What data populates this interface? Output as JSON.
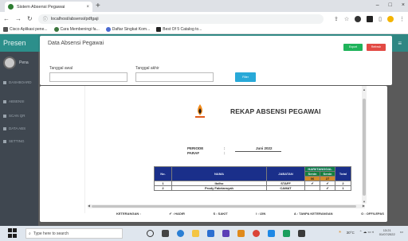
{
  "browser": {
    "tab_title": "Sistem Absensi Pegawai",
    "new_tab": "+",
    "close": "×",
    "win_min": "–",
    "win_max": "□",
    "win_close": "×",
    "url": "localhost/absensi/pdfgaji",
    "bookmarks": [
      {
        "label": "Cisco Aplikasi pene...",
        "color": "#555555"
      },
      {
        "label": "Cara Membeningi fa...",
        "color": "#3c763d"
      },
      {
        "label": "Daftar Singkat Kom...",
        "color": "#4a6ad0"
      },
      {
        "label": "Best Of 5 Catalog to...",
        "color": "#222222"
      }
    ]
  },
  "sidebar": {
    "brand": "Presen",
    "profile_name": "Pena",
    "items": [
      "DASHBOARD",
      "ABSENSI",
      "SCAN QR",
      "DATA ABS",
      "SETTING"
    ]
  },
  "header": {
    "title": "Data Absensi Pegawai",
    "green_button": "Export",
    "red_button": "Refresh",
    "tanggal_awal_label": "Tanggal awal",
    "tanggal_akhir_label": "Tanggal akhir",
    "tanggal_awal_value": "",
    "tanggal_akhir_value": "",
    "filter_button": "Filter"
  },
  "report": {
    "title": "REKAP ABSENSI PEGAWAI",
    "periode_label": "PERIODE",
    "periode_sep": ":",
    "periode_value": "Juni 2022",
    "paraf_label": "PARAF",
    "paraf_sep": ":",
    "columns": {
      "no": "No.",
      "nama": "NAMA",
      "jabatan": "JABATAN",
      "hari_tanggal": "HARI/TANGGAL",
      "day1": "Senin",
      "day2": "Senin",
      "date1": "06",
      "date2": "27",
      "total": "Total"
    },
    "rows": [
      {
        "no": "1",
        "nama": "Ibdho",
        "jabatan": "STAFF",
        "d1": "✔",
        "d2": "✔",
        "total": "2"
      },
      {
        "no": "2",
        "nama": "Prody Fabriansyah",
        "jabatan": "CAMAT",
        "d1": "",
        "d2": "✔",
        "total": "1"
      }
    ],
    "legend": {
      "keterangan": "KETERANGAN :",
      "hadir": "✔ : HADIR",
      "sakit": "S : SAKIT",
      "izin": "I : IJIN",
      "alpa": "A : TANPA KETERANGAN",
      "off": "O : OFF/LEPAS"
    }
  },
  "taskbar": {
    "search_placeholder": "Type here to search",
    "weather": "30°C",
    "time": "13:21",
    "date": "01/07/2022"
  }
}
